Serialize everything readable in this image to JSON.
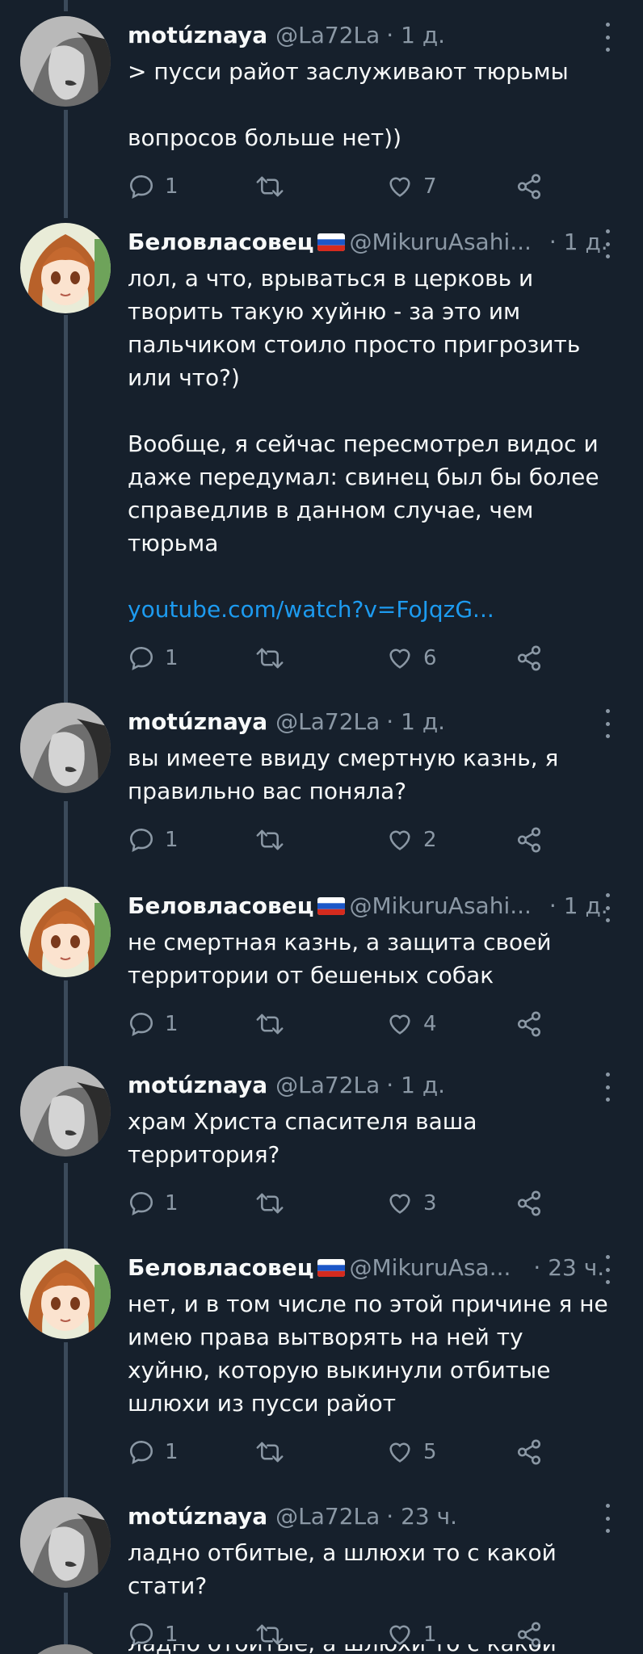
{
  "colors": {
    "background": "#16202c",
    "text": "#f7f9f9",
    "secondary": "#8b98a5",
    "link": "#1d9bf0",
    "thread_line": "#3b4a5a"
  },
  "icons": [
    "reply-icon",
    "retweet-icon",
    "like-icon",
    "share-icon",
    "more-icon",
    "flag-ru-icon"
  ],
  "tweets": [
    {
      "name": "motúznaya",
      "handle": "@La72La",
      "time": "· 1 д.",
      "paragraphs": [
        "> пусси райот заслуживают тюрьмы",
        "вопросов больше нет))"
      ],
      "link": "",
      "replies": "1",
      "likes": "7"
    },
    {
      "name": "Беловласовец",
      "handle": "@MikuruAsahi...",
      "time": "· 1 д.",
      "paragraphs": [
        "лол, а что, врываться в церковь и творить такую хуйню - за это им пальчиком стоило просто пригрозить или что?)",
        "Вообще, я сейчас пересмотрел видос и даже передумал: свинец был бы более справедлив в данном случае, чем тюрьма"
      ],
      "link": "youtube.com/watch?v=FoJqzG...",
      "replies": "1",
      "likes": "6"
    },
    {
      "name": "motúznaya",
      "handle": "@La72La",
      "time": "· 1 д.",
      "paragraphs": [
        "вы имеете ввиду смертную казнь, я правильно вас поняла?"
      ],
      "link": "",
      "replies": "1",
      "likes": "2"
    },
    {
      "name": "Беловласовец",
      "handle": "@MikuruAsahi...",
      "time": "· 1 д.",
      "paragraphs": [
        "не смертная казнь, а защита своей территории от бешеных собак"
      ],
      "link": "",
      "replies": "1",
      "likes": "4"
    },
    {
      "name": "motúznaya",
      "handle": "@La72La",
      "time": "· 1 д.",
      "paragraphs": [
        "храм Христа спасителя ваша территория?"
      ],
      "link": "",
      "replies": "1",
      "likes": "3"
    },
    {
      "name": "Беловласовец",
      "handle": "@MikuruAsa...",
      "time": "· 23 ч.",
      "paragraphs": [
        "нет, и в том числе по этой причине я не имею права вытворять на ней ту хуйню, которую выкинули отбитые шлюхи из пусси райот"
      ],
      "link": "",
      "replies": "1",
      "likes": "5"
    },
    {
      "name": "motúznaya",
      "handle": "@La72La",
      "time": "· 23 ч.",
      "paragraphs": [
        "ладно отбитые, а шлюхи то с какой стати?"
      ],
      "link": "",
      "replies": "1",
      "likes": "1"
    }
  ],
  "cut_off_text": "ладно отбитые, а шлюхи то с какой"
}
